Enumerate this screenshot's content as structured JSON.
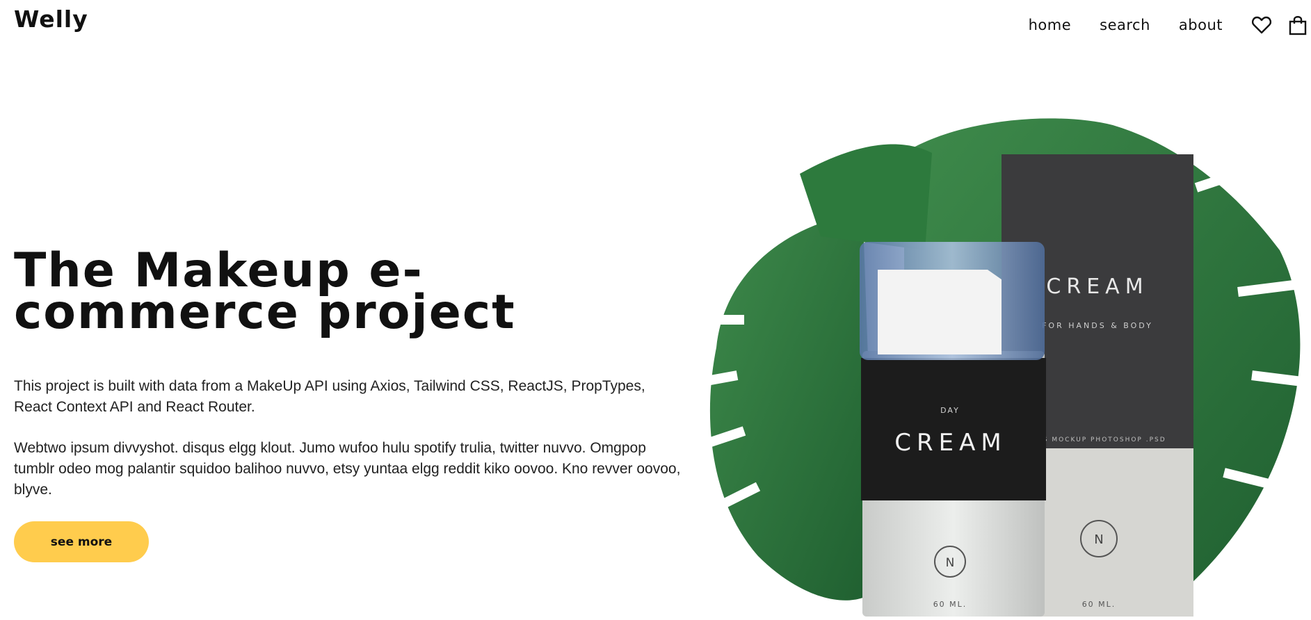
{
  "header": {
    "logo": "Welly",
    "nav": [
      {
        "label": "home"
      },
      {
        "label": "search"
      },
      {
        "label": "about"
      }
    ],
    "icons": [
      "heart-icon",
      "shopping-bag-icon"
    ]
  },
  "hero": {
    "title": "The Makeup e-commerce project",
    "paragraph1": "This project is built with data from a MakeUp API using Axios, Tailwind CSS, ReactJS, PropTypes, React Context API and React Router.",
    "paragraph2": "Webtwo ipsum divvyshot. disqus elgg klout. Jumo wufoo hulu spotify trulia, twitter nuvvo. Omgpop tumblr odeo mog palantir squidoo balihoo nuvvo, etsy yuntaa elgg reddit kiko oovoo. Kno revver oovoo, blyve.",
    "cta_label": "see more"
  },
  "product_image": {
    "bottle": {
      "top_label": "DAY",
      "name": "CREAM",
      "badge": "N",
      "volume": "60 ML."
    },
    "box": {
      "name": "CREAM",
      "subtitle": "FOR HANDS & BODY",
      "strip": "TICS MOCKUP  PHOTOSHOP .PSD",
      "badge": "N",
      "volume": "60 ML."
    }
  },
  "colors": {
    "accent": "#ffcc4d",
    "leaf": "#2f7a3e",
    "box": "#3b3b3d",
    "bottle_band": "#1c1c1c"
  }
}
